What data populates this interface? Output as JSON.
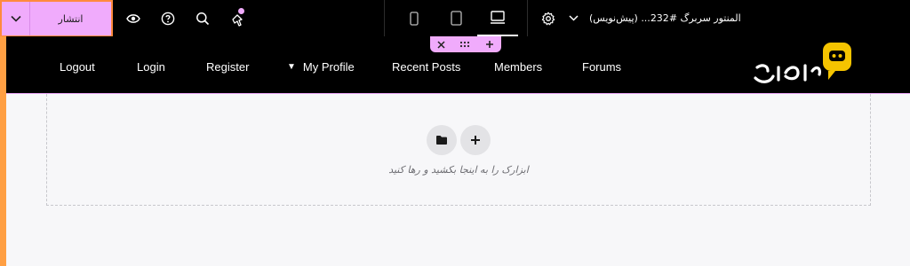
{
  "topbar": {
    "publish_label": "انتشار",
    "document_title": "المنتور سربرگ #232... (پیش‌نویس)",
    "icons": [
      "chevron-down-icon",
      "eye-icon",
      "help-icon",
      "search-icon",
      "notification-icon",
      "mobile-icon",
      "tablet-icon",
      "desktop-icon",
      "gear-icon"
    ]
  },
  "header": {
    "nav": [
      {
        "label": "Logout"
      },
      {
        "label": "Login"
      },
      {
        "label": "Register"
      },
      {
        "label": "My Profile"
      },
      {
        "label": "Recent Posts"
      },
      {
        "label": "Members"
      },
      {
        "label": "Forums"
      }
    ],
    "logo_text": "راردپرس"
  },
  "content": {
    "drop_hint": "ابزارک را به اینجا بکشید و رها کنید"
  },
  "colors": {
    "accent": "#f0abfc",
    "frame": "#ff9f43",
    "bar": "#000000"
  }
}
